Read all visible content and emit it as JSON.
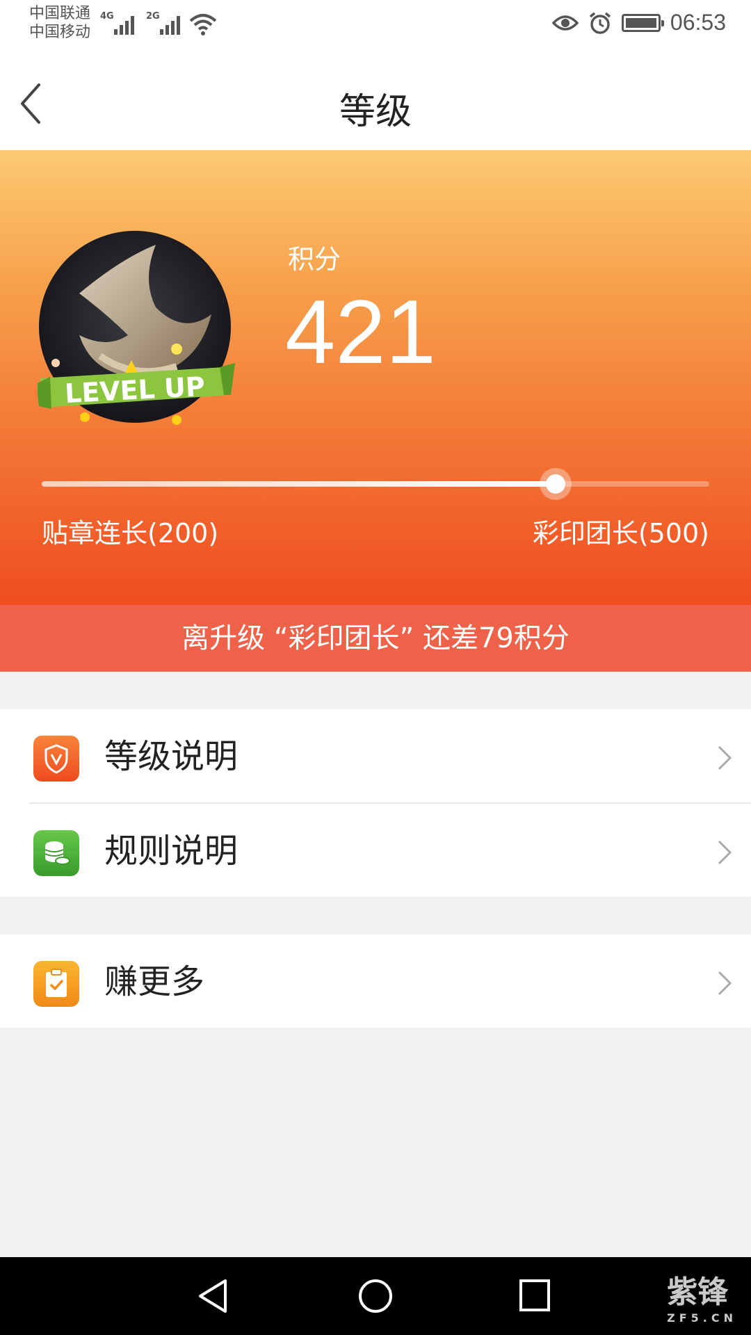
{
  "status_bar": {
    "carrier_1": "中国联通",
    "carrier_2": "中国移动",
    "network_1": "4G",
    "network_2": "2G",
    "time": "06:53"
  },
  "header": {
    "title": "等级"
  },
  "hero": {
    "score_label": "积分",
    "score_value": "421",
    "badge_text": "LEVEL UP",
    "current_level": "贴章连长(200)",
    "next_level": "彩印团长(500)",
    "progress_fraction": 0.77
  },
  "banner": {
    "text": "离升级 “彩印团长” 还差79积分"
  },
  "menu_group_1": [
    {
      "label": "等级说明",
      "icon": "shield-v-icon"
    },
    {
      "label": "规则说明",
      "icon": "coins-icon"
    }
  ],
  "menu_group_2": [
    {
      "label": "赚更多",
      "icon": "clipboard-check-icon"
    }
  ],
  "watermark": {
    "title": "紫锋",
    "subtitle": "ZF5.CN"
  },
  "colors": {
    "accent": "#ef4d20",
    "banner": "#ee624a",
    "icon_orange": "#f0632e",
    "icon_green": "#4fb43a",
    "icon_yellow": "#f5a623"
  }
}
